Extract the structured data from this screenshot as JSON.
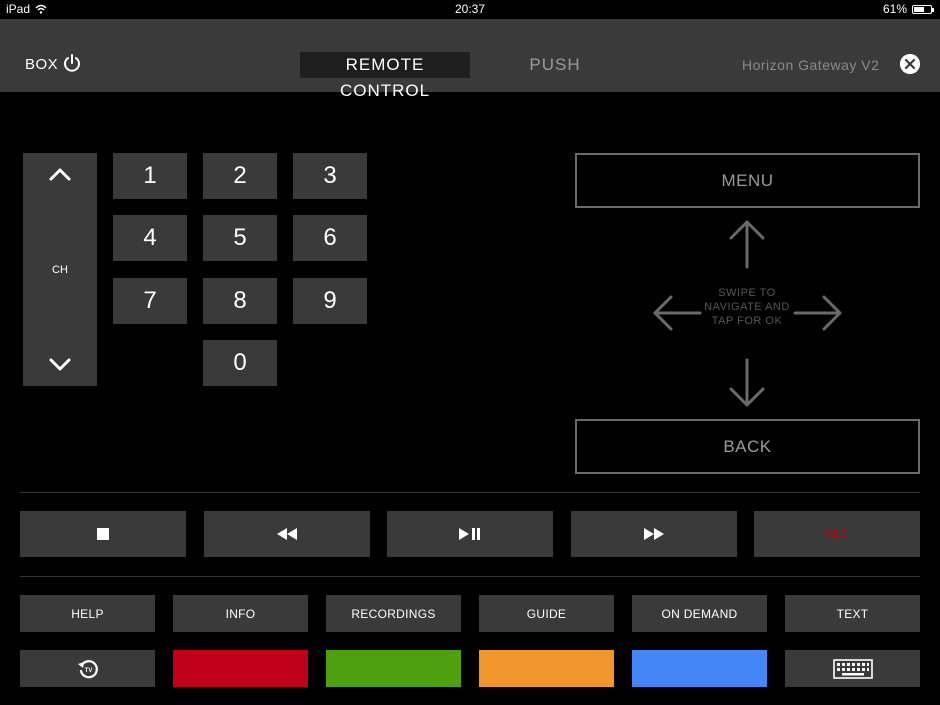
{
  "status_bar": {
    "carrier": "iPad",
    "time": "20:37",
    "battery": "61%",
    "battery_level": 0.61,
    "wifi_icon": "wifi-icon",
    "battery_icon": "battery-icon"
  },
  "header": {
    "box_label": "BOX",
    "power_icon": "power-icon",
    "tabs": [
      {
        "label": "REMOTE CONTROL",
        "active": true
      },
      {
        "label": "PUSH",
        "active": false
      }
    ],
    "device_name": "Horizon Gateway V2",
    "close_icon": "close-icon"
  },
  "channel": {
    "label": "CH",
    "up_icon": "chevron-up-icon",
    "down_icon": "chevron-down-icon"
  },
  "numpad": [
    "1",
    "2",
    "3",
    "4",
    "5",
    "6",
    "7",
    "8",
    "9",
    "0"
  ],
  "navigation": {
    "menu_label": "MENU",
    "back_label": "BACK",
    "swipe_text": "SWIPE TO NAVIGATE AND TAP FOR OK"
  },
  "media_controls": [
    {
      "icon": "stop-icon"
    },
    {
      "icon": "rewind-icon"
    },
    {
      "icon": "play-pause-icon"
    },
    {
      "icon": "fast-forward-icon"
    },
    {
      "label": "REC",
      "color": "#c0001a"
    }
  ],
  "function_buttons": [
    "HELP",
    "INFO",
    "RECORDINGS",
    "GUIDE",
    "ON DEMAND",
    "TEXT"
  ],
  "bottom_row": {
    "tv_icon": "tv-replay-icon",
    "colors": [
      "#c0001a",
      "#4fa00f",
      "#f0962a",
      "#4486f4"
    ],
    "keyboard_icon": "keyboard-icon"
  }
}
